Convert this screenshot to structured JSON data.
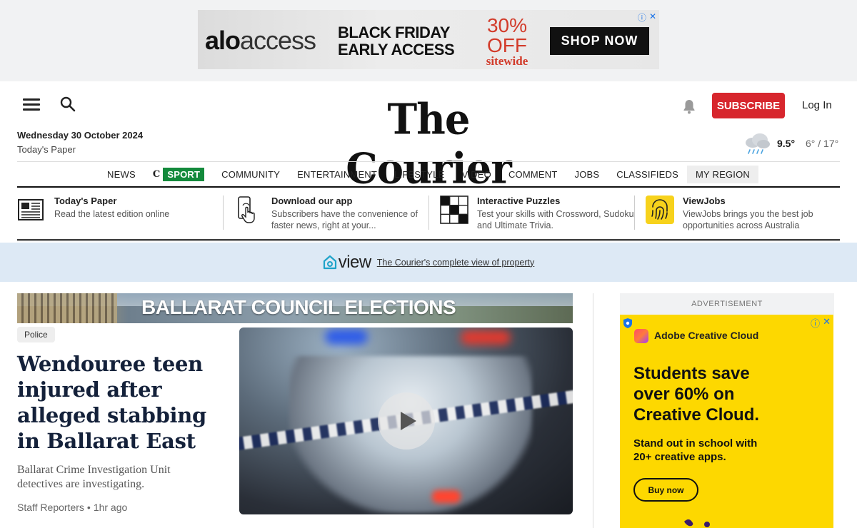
{
  "top_ad": {
    "brand_bold": "alo",
    "brand_rest": "access",
    "headline_line1": "BLACK FRIDAY",
    "headline_line2": "EARLY ACCESS",
    "offer": "30% OFF",
    "offer_sub": "sitewide",
    "cta": "SHOP NOW",
    "info_icon": "ⓘ",
    "close_icon": "✕"
  },
  "header": {
    "masthead": "The Courier",
    "date": "Wednesday 30 October 2024",
    "todays_paper": "Today's Paper",
    "subscribe": "SUBSCRIBE",
    "login": "Log In",
    "weather": {
      "current": "9.5°",
      "range": "6° / 17°"
    }
  },
  "nav": {
    "items": [
      {
        "label": "NEWS"
      },
      {
        "label": "SPORT"
      },
      {
        "label": "COMMUNITY"
      },
      {
        "label": "ENTERTAINMENT"
      },
      {
        "label": "LIFESTYLE"
      },
      {
        "label": "VIDEO"
      },
      {
        "label": "COMMENT"
      },
      {
        "label": "JOBS"
      },
      {
        "label": "CLASSIFIEDS"
      },
      {
        "label": "MY REGION"
      }
    ],
    "sport_mark": "C"
  },
  "promos": [
    {
      "title": "Today's Paper",
      "desc": "Read the latest edition online",
      "icon": "newspaper-icon"
    },
    {
      "title": "Download our app",
      "desc": "Subscribers have the convenience of faster news, right at your...",
      "icon": "phone-tap-icon"
    },
    {
      "title": "Interactive Puzzles",
      "desc": "Test your skills with Crossword, Sudoku and Ultimate Trivia.",
      "icon": "crossword-icon"
    },
    {
      "title": "ViewJobs",
      "desc": "ViewJobs brings you the best job opportunities across Australia",
      "icon": "fingerprint-icon"
    }
  ],
  "view_banner": {
    "logo": "view",
    "link": "The Courier's complete view of property"
  },
  "elections_banner": {
    "title": "BALLARAT COUNCIL ELECTIONS"
  },
  "lead_story": {
    "tag": "Police",
    "headline": "Wendouree teen injured after alleged stabbing in Ballarat East",
    "standfirst": "Ballarat Crime Investigation Unit detectives are investigating.",
    "author": "Staff Reporters",
    "separator": "•",
    "time": "1hr ago"
  },
  "side_ad": {
    "label": "ADVERTISEMENT",
    "brand": "Adobe Creative Cloud",
    "headline_line1": "Students save",
    "headline_line2": "over 60% on",
    "headline_line3": "Creative Cloud.",
    "sub_line1": "Stand out in school with",
    "sub_line2": "20+ creative apps.",
    "cta": "Buy now",
    "info_icon": "ⓘ",
    "close_icon": "✕"
  },
  "colors": {
    "subscribe": "#d7262d",
    "sport_badge": "#138a3c",
    "view_banner_bg": "#dde9f5",
    "side_ad_bg": "#fdd800",
    "headline": "#14213a"
  }
}
